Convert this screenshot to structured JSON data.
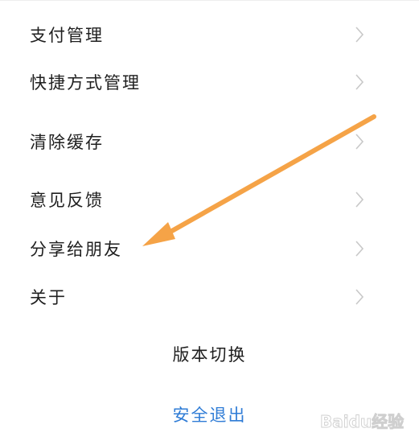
{
  "menu": {
    "items": [
      {
        "label": "支付管理",
        "icon": "chevron-right-icon"
      },
      {
        "label": "快捷方式管理",
        "icon": "chevron-right-icon"
      },
      {
        "label": "清除缓存",
        "icon": "chevron-right-icon"
      },
      {
        "label": "意见反馈",
        "icon": "chevron-right-icon"
      },
      {
        "label": "分享给朋友",
        "icon": "chevron-right-icon"
      },
      {
        "label": "关于",
        "icon": "chevron-right-icon"
      }
    ]
  },
  "actions": {
    "version_switch": "版本切换",
    "logout": "安全退出"
  },
  "annotation": {
    "arrow_color": "#f5a347",
    "points_to": "分享给朋友"
  },
  "watermark": {
    "text": "Baidu经验"
  },
  "colors": {
    "text": "#1f1f1f",
    "logout": "#2f7cd6",
    "chevron": "#c8c8c8"
  }
}
